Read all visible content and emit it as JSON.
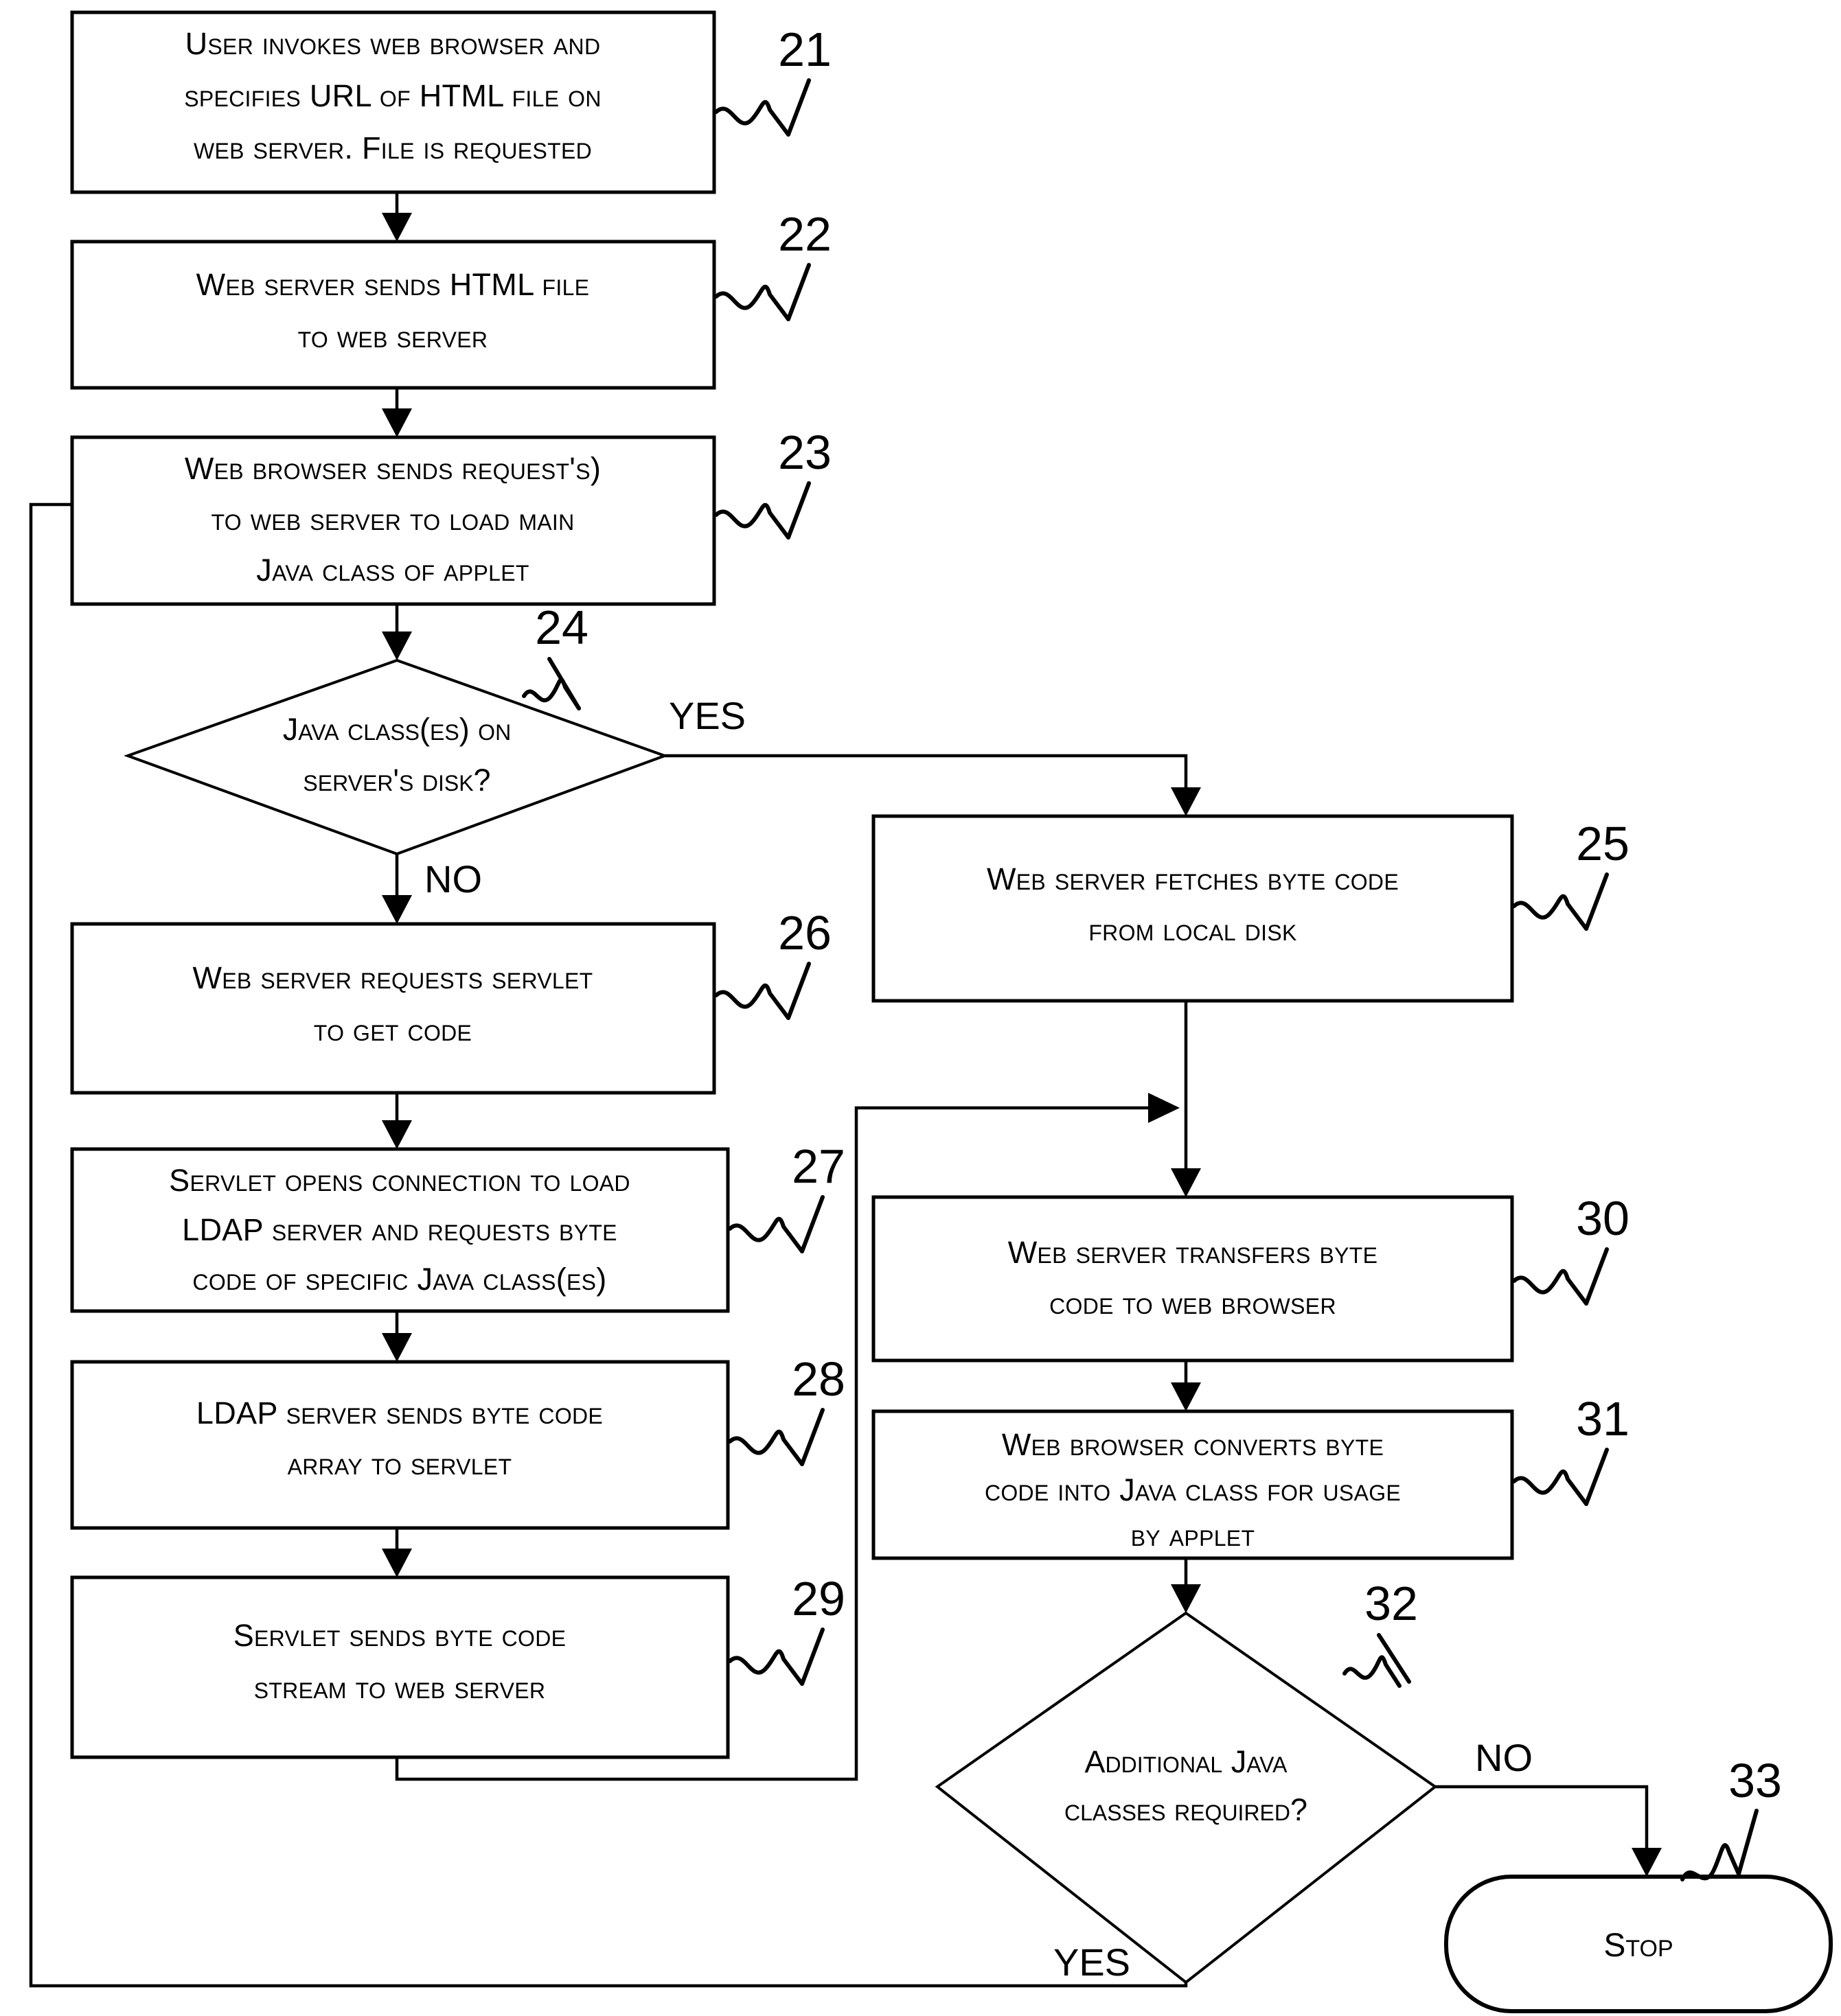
{
  "diagram": {
    "title": "Flowchart: Java applet byte code loading via web server, servlet and LDAP server",
    "type": "flowchart",
    "background_color": "#ffffff",
    "line_color": "#000000"
  },
  "nodes": [
    {
      "id": "n21",
      "ref": "21",
      "shape": "process",
      "lines": [
        "User invokes web browser and",
        "specifies URL of HTML file on",
        "web server. File is requested"
      ]
    },
    {
      "id": "n22",
      "ref": "22",
      "shape": "process",
      "lines": [
        "Web server sends HTML file",
        "to web server"
      ]
    },
    {
      "id": "n23",
      "ref": "23",
      "shape": "process",
      "lines": [
        "Web browser sends request's)",
        "to web server to load main",
        "Java class of applet"
      ]
    },
    {
      "id": "n24",
      "ref": "24",
      "shape": "decision",
      "lines": [
        "Java class(es) on",
        "server's disk?"
      ]
    },
    {
      "id": "n25",
      "ref": "25",
      "shape": "process",
      "lines": [
        "Web server fetches byte code",
        "from local disk"
      ]
    },
    {
      "id": "n26",
      "ref": "26",
      "shape": "process",
      "lines": [
        "Web server requests servlet",
        "to get code"
      ]
    },
    {
      "id": "n27",
      "ref": "27",
      "shape": "process",
      "lines": [
        "Servlet opens connection to load",
        "LDAP server and requests byte",
        "code of specific Java class(es)"
      ]
    },
    {
      "id": "n28",
      "ref": "28",
      "shape": "process",
      "lines": [
        "LDAP server sends byte code",
        "array to servlet"
      ]
    },
    {
      "id": "n29",
      "ref": "29",
      "shape": "process",
      "lines": [
        "Servlet sends byte code",
        "stream to web server"
      ]
    },
    {
      "id": "n30",
      "ref": "30",
      "shape": "process",
      "lines": [
        "Web server transfers byte",
        "code to web browser"
      ]
    },
    {
      "id": "n31",
      "ref": "31",
      "shape": "process",
      "lines": [
        "Web browser converts byte",
        "code into Java class for usage",
        "by applet"
      ]
    },
    {
      "id": "n32",
      "ref": "32",
      "shape": "decision",
      "lines": [
        "Additional Java",
        "classes required?"
      ]
    },
    {
      "id": "n33",
      "ref": "33",
      "shape": "terminator",
      "lines": [
        "Stop"
      ]
    }
  ],
  "branch_labels": {
    "d24_yes": "YES",
    "d24_no": "NO",
    "d32_no": "NO",
    "d32_yes": "YES"
  },
  "ref_numbers": [
    "21",
    "22",
    "23",
    "24",
    "25",
    "26",
    "27",
    "28",
    "29",
    "30",
    "31",
    "32",
    "33"
  ]
}
